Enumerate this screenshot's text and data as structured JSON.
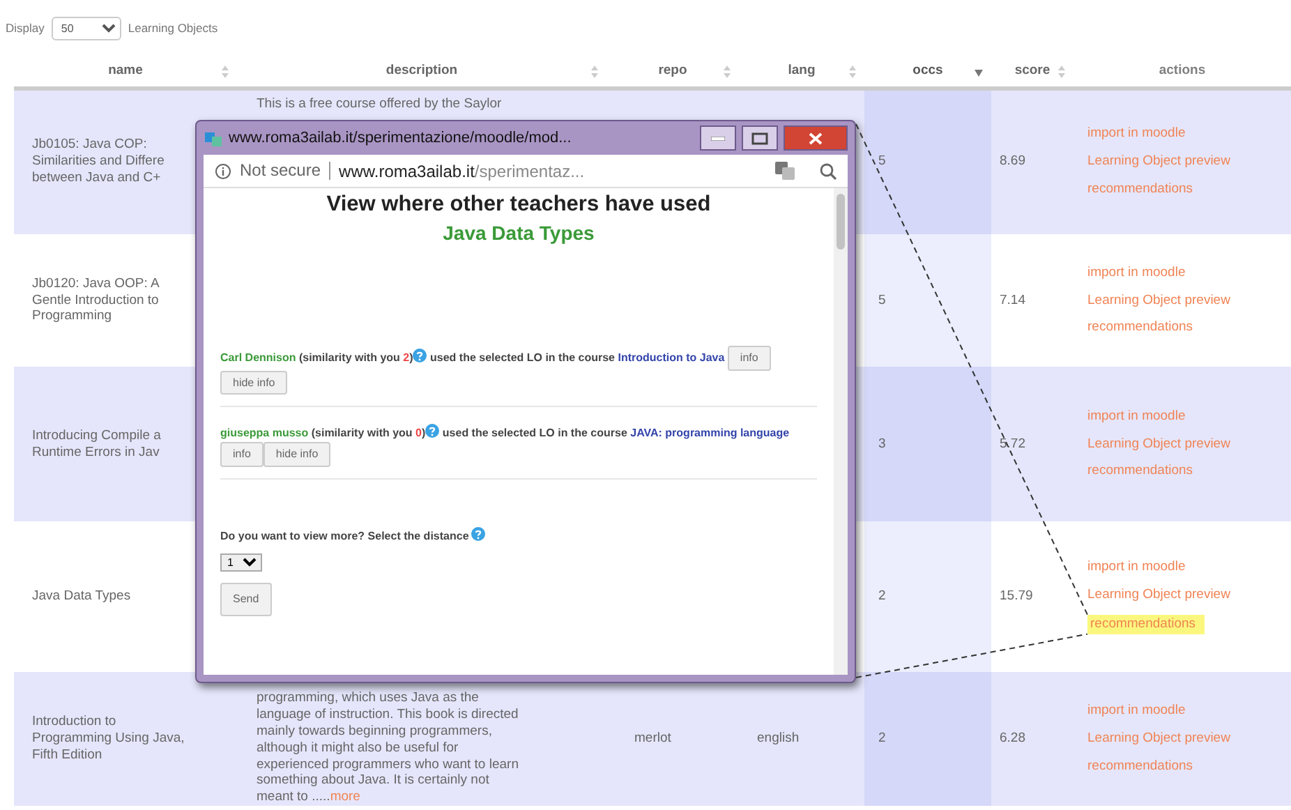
{
  "display": {
    "label": "Display",
    "value": "50",
    "suffix": "Learning Objects"
  },
  "table": {
    "columns": [
      {
        "label": "name",
        "sortable": true,
        "sorted": false
      },
      {
        "label": "description",
        "sortable": true,
        "sorted": false
      },
      {
        "label": "repo",
        "sortable": true,
        "sorted": false
      },
      {
        "label": "lang",
        "sortable": true,
        "sorted": false
      },
      {
        "label": "occs",
        "sortable": true,
        "sorted": true
      },
      {
        "label": "score",
        "sortable": true,
        "sorted": false
      },
      {
        "label": "actions",
        "sortable": false,
        "sorted": false
      }
    ],
    "rows": [
      {
        "name": "Jb0105: Java COP:\nSimilarities and Differe\nbetween Java and C+",
        "description": "This is a free course offered by the Saylor",
        "occs": "5",
        "score": "8.69",
        "actions": [
          {
            "label": "import in moodle",
            "highlighted": false
          },
          {
            "label": "Learning Object preview",
            "highlighted": false
          },
          {
            "label": "recommendations",
            "highlighted": false
          }
        ]
      },
      {
        "name": "Jb0120: Java OOP: A\nGentle Introduction to\nProgramming",
        "occs": "5",
        "score": "7.14",
        "actions": [
          {
            "label": "import in moodle",
            "highlighted": false
          },
          {
            "label": "Learning Object preview",
            "highlighted": false
          },
          {
            "label": "recommendations",
            "highlighted": false
          }
        ]
      },
      {
        "name": "Introducing Compile a\nRuntime Errors in Jav",
        "occs": "3",
        "score": "5.72",
        "actions": [
          {
            "label": "import in moodle",
            "highlighted": false
          },
          {
            "label": "Learning Object preview",
            "highlighted": false
          },
          {
            "label": "recommendations",
            "highlighted": false
          }
        ]
      },
      {
        "name": "Java Data Types",
        "occs": "2",
        "score": "15.79",
        "actions": [
          {
            "label": "import in moodle",
            "highlighted": false
          },
          {
            "label": "Learning Object preview",
            "highlighted": false
          },
          {
            "label": "recommendations",
            "highlighted": true
          }
        ]
      },
      {
        "name": "Introduction to\nProgramming Using Java,\nFifth Edition",
        "description": "programming, which uses Java as the\nlanguage of instruction. This book is directed\nmainly towards beginning programmers,\nalthough it might also be useful for\nexperienced programmers who want to learn\nsomething about Java. It is certainly not\nmeant to .....",
        "more_link": "more",
        "repo": "merlot",
        "lang": "english",
        "occs": "2",
        "score": "6.28",
        "actions": [
          {
            "label": "import in moodle",
            "highlighted": false
          },
          {
            "label": "Learning Object preview",
            "highlighted": false
          },
          {
            "label": "recommendations",
            "highlighted": false
          }
        ]
      }
    ]
  },
  "popup": {
    "title": "www.roma3ailab.it/sperimentazione/moodle/mod...",
    "security": "Not secure",
    "url_host": "www.roma3ailab.it",
    "url_path": "/sperimentaz...",
    "heading": "View where other teachers have used",
    "subject": "Java Data Types",
    "entries": [
      {
        "teacher": "Carl Dennison",
        "similarity": "(similarity with you **2**)",
        "used_text": "used the selected LO in the course",
        "course": "Introduction to Java",
        "buttons": [
          "info",
          "hide info"
        ]
      },
      {
        "teacher": "giuseppa musso",
        "similarity": "(similarity with you **0**)",
        "used_text": "used the selected LO in the course",
        "course": "JAVA: programming language",
        "buttons": [
          "info",
          "hide info"
        ]
      }
    ],
    "question": "Do you want to view more? Select the distance",
    "distance": "1",
    "send": "Send"
  }
}
